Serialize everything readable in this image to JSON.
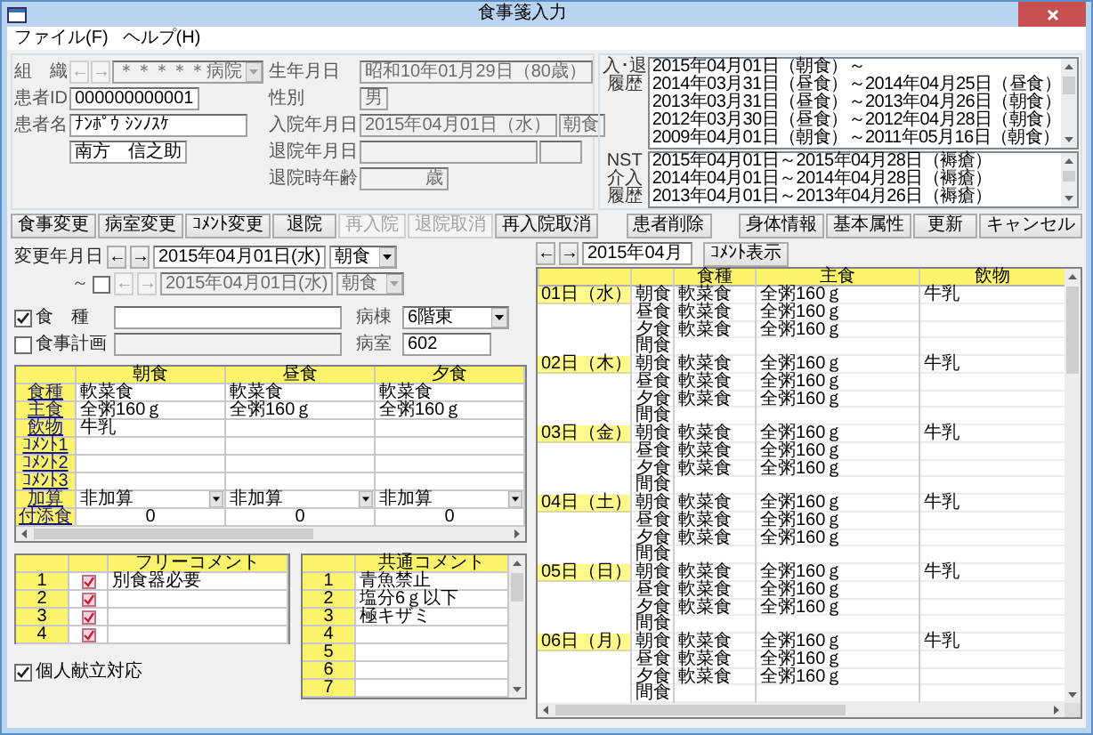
{
  "window": {
    "title": "食事箋入力"
  },
  "menu": [
    "ファイル(F)",
    "ヘルプ(H)"
  ],
  "patient": {
    "org_label": "組　織",
    "org_nav": {
      "arrows": [
        "←",
        "→"
      ],
      "disabled": true
    },
    "org_value": "＊＊＊＊＊病院",
    "id_label": "患者ID",
    "id_value": "000000000001",
    "name_label": "患者名",
    "name_kana": "ﾅﾝﾎﾟｳ ｼﾝﾉｽｹ",
    "name": "南方　信之助"
  },
  "dates": {
    "birth_label": "生年月日",
    "birth_value": "昭和10年01月29日（80歳）",
    "sex_label": "性別",
    "sex_value": "男",
    "admit_label": "入院年月日",
    "admit_value": "2015年04月01日（水）",
    "admit_meal": "朝食",
    "discharge_label": "退院年月日",
    "age_label": "退院時年齢",
    "age_unit": "歳"
  },
  "history": {
    "label": [
      "入･退",
      "履歴"
    ],
    "lines": [
      "2015年04月01日（朝食）～",
      "2014年03月31日（昼食）～2014年04月25日（昼食）",
      "2013年03月31日（昼食）～2013年04月26日（朝食）",
      "2012年03月30日（昼食）～2012年04月28日（朝食）",
      "2009年04月01日（朝食）～2011年05月16日（朝食）"
    ]
  },
  "nst_history": {
    "label": [
      "NST介入",
      "履歴"
    ],
    "lines": [
      "2015年04月01日～2015年04月28日（褥瘡）",
      "2014年04月01日～2014年04月28日（褥瘡）",
      "2013年04月01日～2013年04月26日（褥瘡）"
    ]
  },
  "record_buttons": [
    {
      "label": "食事変更",
      "disabled": false
    },
    {
      "label": "病室変更",
      "disabled": false
    },
    {
      "label": "ｺﾒﾝﾄ変更",
      "disabled": false
    },
    {
      "label": "退院",
      "disabled": false
    },
    {
      "label": "再入院",
      "disabled": true
    },
    {
      "label": "退院取消",
      "disabled": true
    },
    {
      "label": "再入院取消",
      "disabled": false
    }
  ],
  "patient_buttons": [
    {
      "label": "患者削除",
      "disabled": false
    }
  ],
  "dialog_buttons": [
    {
      "label": "身体情報",
      "disabled": false
    },
    {
      "label": "基本属性",
      "disabled": false
    },
    {
      "label": "更新",
      "disabled": false
    },
    {
      "label": "キャンセル",
      "disabled": false
    }
  ],
  "change": {
    "label": "変更年月日",
    "arrows": [
      "←",
      "→"
    ],
    "date": "2015年04月01日(水)",
    "meal": "朝食",
    "range_mark": "～",
    "range_checked": false,
    "end_arrows": [
      "←",
      "→"
    ],
    "end_date": "2015年04月01日(水)",
    "end_meal": "朝食"
  },
  "diet": {
    "label": "食　種",
    "checked": true
  },
  "plan": {
    "label": "食事計画",
    "checked": false
  },
  "ward": {
    "label": "病棟",
    "value": "6階東"
  },
  "room": {
    "label": "病室",
    "value": "602"
  },
  "meal_grid": {
    "columns": [
      "朝食",
      "昼食",
      "夕食"
    ],
    "rows": [
      {
        "label": "食種",
        "kind": "text",
        "cells": [
          "軟菜食",
          "軟菜食",
          "軟菜食"
        ]
      },
      {
        "label": "主食",
        "kind": "text",
        "cells": [
          "全粥160ｇ",
          "全粥160ｇ",
          "全粥160ｇ"
        ]
      },
      {
        "label": "飲物",
        "kind": "text",
        "cells": [
          "牛乳"
        ]
      },
      {
        "label": "ｺﾒﾝﾄ1",
        "kind": "text"
      },
      {
        "label": "ｺﾒﾝﾄ2",
        "kind": "text"
      },
      {
        "label": "ｺﾒﾝﾄ3",
        "kind": "text"
      },
      {
        "label": "加算",
        "kind": "dropdown",
        "cells": [
          "非加算",
          "非加算",
          "非加算"
        ]
      },
      {
        "label": "付添食",
        "kind": "number",
        "cells": [
          "0",
          "0",
          "0"
        ]
      }
    ]
  },
  "free_comments": {
    "header": "フリーコメント",
    "rows": [
      {
        "number": "1",
        "text": "別食器必要"
      },
      {
        "number": "2"
      },
      {
        "number": "3"
      },
      {
        "number": "4"
      }
    ]
  },
  "personal_menu": {
    "label": "個人献立対応",
    "checked": true
  },
  "common_comments": {
    "header": "共通コメント",
    "rows": [
      {
        "number": "1",
        "text": "青魚禁止"
      },
      {
        "number": "2",
        "text": "塩分6ｇ以下"
      },
      {
        "number": "3",
        "text": "極キザミ"
      },
      {
        "number": "4"
      },
      {
        "number": "5"
      },
      {
        "number": "6"
      },
      {
        "number": "7"
      }
    ]
  },
  "calendar": {
    "arrows": [
      "←",
      "→"
    ],
    "month": "2015年04月",
    "comment_button": "ｺﾒﾝﾄ表示",
    "columns": [
      "食種",
      "主食",
      "飲物"
    ],
    "days": [
      {
        "date": "01日（水）",
        "meals": [
          {
            "meal": "朝食",
            "diet": "軟菜食",
            "staple": "全粥160ｇ",
            "drink": "牛乳"
          },
          {
            "meal": "昼食",
            "diet": "軟菜食",
            "staple": "全粥160ｇ"
          },
          {
            "meal": "夕食",
            "diet": "軟菜食",
            "staple": "全粥160ｇ"
          },
          {
            "meal": "間食"
          }
        ]
      },
      {
        "date": "02日（木）",
        "meals": [
          {
            "meal": "朝食",
            "diet": "軟菜食",
            "staple": "全粥160ｇ",
            "drink": "牛乳"
          },
          {
            "meal": "昼食",
            "diet": "軟菜食",
            "staple": "全粥160ｇ"
          },
          {
            "meal": "夕食",
            "diet": "軟菜食",
            "staple": "全粥160ｇ"
          },
          {
            "meal": "間食"
          }
        ]
      },
      {
        "date": "03日（金）",
        "meals": [
          {
            "meal": "朝食",
            "diet": "軟菜食",
            "staple": "全粥160ｇ",
            "drink": "牛乳"
          },
          {
            "meal": "昼食",
            "diet": "軟菜食",
            "staple": "全粥160ｇ"
          },
          {
            "meal": "夕食",
            "diet": "軟菜食",
            "staple": "全粥160ｇ"
          },
          {
            "meal": "間食"
          }
        ]
      },
      {
        "date": "04日（土）",
        "meals": [
          {
            "meal": "朝食",
            "diet": "軟菜食",
            "staple": "全粥160ｇ",
            "drink": "牛乳"
          },
          {
            "meal": "昼食",
            "diet": "軟菜食",
            "staple": "全粥160ｇ"
          },
          {
            "meal": "夕食",
            "diet": "軟菜食",
            "staple": "全粥160ｇ"
          },
          {
            "meal": "間食"
          }
        ]
      },
      {
        "date": "05日（日）",
        "meals": [
          {
            "meal": "朝食",
            "diet": "軟菜食",
            "staple": "全粥160ｇ",
            "drink": "牛乳"
          },
          {
            "meal": "昼食",
            "diet": "軟菜食",
            "staple": "全粥160ｇ"
          },
          {
            "meal": "夕食",
            "diet": "軟菜食",
            "staple": "全粥160ｇ"
          },
          {
            "meal": "間食"
          }
        ]
      },
      {
        "date": "06日（月）",
        "meals": [
          {
            "meal": "朝食",
            "diet": "軟菜食",
            "staple": "全粥160ｇ",
            "drink": "牛乳"
          },
          {
            "meal": "昼食",
            "diet": "軟菜食",
            "staple": "全粥160ｇ"
          },
          {
            "meal": "夕食",
            "diet": "軟菜食",
            "staple": "全粥160ｇ"
          },
          {
            "meal": "間食"
          }
        ]
      }
    ]
  }
}
